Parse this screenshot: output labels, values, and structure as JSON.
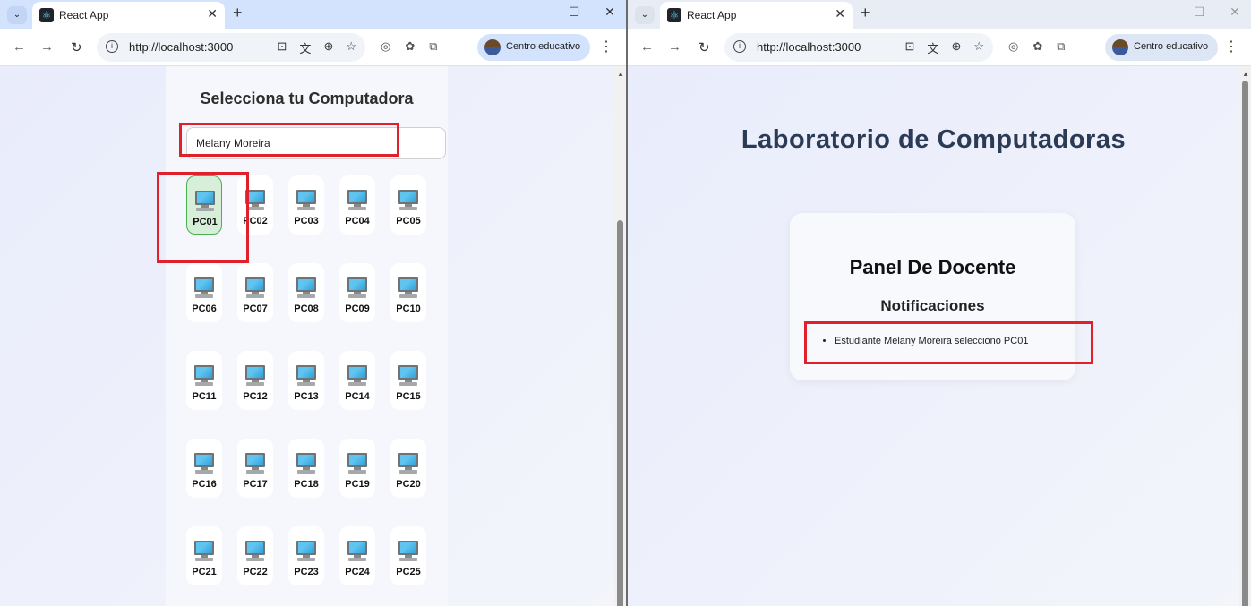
{
  "left_window": {
    "tab_title": "React App",
    "url": "http://localhost:3000",
    "profile_name": "Centro educativo",
    "app": {
      "heading": "Selecciona tu Computadora",
      "student_name_value": "Melany Moreira",
      "selected_pc": "PC01",
      "computers": [
        "PC01",
        "PC02",
        "PC03",
        "PC04",
        "PC05",
        "PC06",
        "PC07",
        "PC08",
        "PC09",
        "PC10",
        "PC11",
        "PC12",
        "PC13",
        "PC14",
        "PC15",
        "PC16",
        "PC17",
        "PC18",
        "PC19",
        "PC20",
        "PC21",
        "PC22",
        "PC23",
        "PC24",
        "PC25"
      ]
    }
  },
  "right_window": {
    "tab_title": "React App",
    "url": "http://localhost:3000",
    "profile_name": "Centro educativo",
    "app": {
      "heading": "Laboratorio de Computadoras",
      "panel_title": "Panel De Docente",
      "notifications_title": "Notificaciones",
      "notifications": [
        "Estudiante Melany Moreira seleccionó PC01"
      ]
    }
  },
  "icons": {
    "tab_dropdown": "chevron-down-icon",
    "favicon": "react-logo-icon",
    "tab_close": "close-icon",
    "new_tab": "plus-icon",
    "minimize": "minimize-icon",
    "maximize": "maximize-icon",
    "close_window": "close-window-icon",
    "back": "back-arrow-icon",
    "forward": "forward-arrow-icon",
    "reload": "reload-icon",
    "site_info": "info-icon",
    "install_app": "install-icon",
    "translate": "translate-icon",
    "zoom": "zoom-icon",
    "bookmark": "star-icon",
    "menu": "more-vert-icon",
    "computer": "monitor-icon"
  },
  "colors": {
    "highlight_box": "#e0202a",
    "selected_card_bg": "#d7efd8",
    "selected_card_border": "#4caf50",
    "heading": "#2b3a55"
  }
}
